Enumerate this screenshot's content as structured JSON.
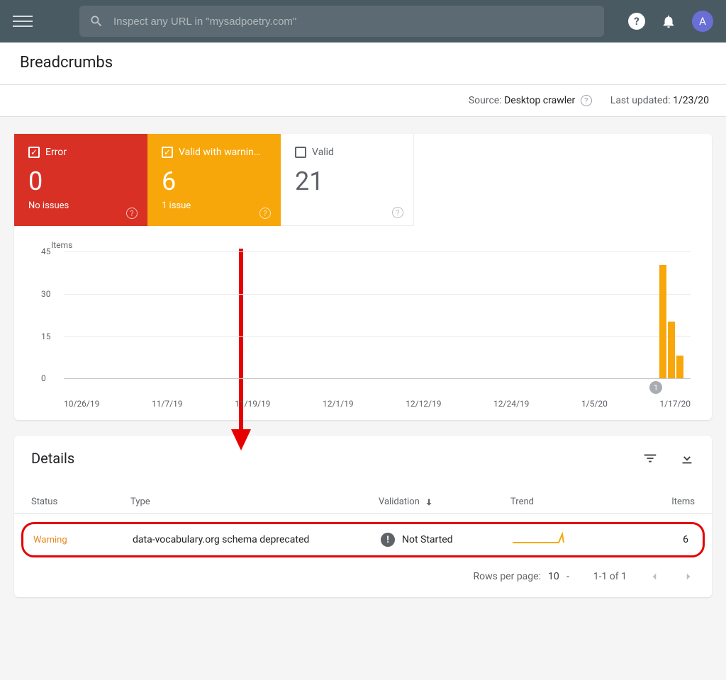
{
  "appbar": {
    "search_placeholder": "Inspect any URL in \"mysadpoetry.com\"",
    "avatar_initial": "A"
  },
  "page": {
    "title": "Breadcrumbs"
  },
  "meta": {
    "source_label": "Source:",
    "source_value": "Desktop crawler",
    "updated_label": "Last updated:",
    "updated_value": "1/23/20"
  },
  "tabs": {
    "error": {
      "label": "Error",
      "count": "0",
      "sub": "No issues"
    },
    "warn": {
      "label": "Valid with warnin…",
      "count": "6",
      "sub": "1 issue"
    },
    "valid": {
      "label": "Valid",
      "count": "21"
    }
  },
  "chart_data": {
    "type": "bar",
    "ylabel": "Items",
    "ylim": [
      0,
      45
    ],
    "y_ticks": [
      0,
      15,
      30,
      45
    ],
    "x_ticks": [
      "10/26/19",
      "11/7/19",
      "11/19/19",
      "12/1/19",
      "12/12/19",
      "12/24/19",
      "1/5/20",
      "1/17/20"
    ],
    "series": [
      {
        "name": "Valid with warnings",
        "bars": [
          {
            "x": "1/21/20",
            "value": 40
          },
          {
            "x": "1/22/20",
            "value": 20
          },
          {
            "x": "1/23/20",
            "value": 8
          }
        ]
      }
    ],
    "annotation": {
      "badge": "1"
    }
  },
  "details": {
    "title": "Details",
    "columns": {
      "status": "Status",
      "type": "Type",
      "validation": "Validation",
      "trend": "Trend",
      "items": "Items"
    },
    "row": {
      "status": "Warning",
      "type": "data-vocabulary.org schema deprecated",
      "validation": "Not Started",
      "items": "6"
    },
    "pager": {
      "rows_label": "Rows per page:",
      "rows_value": "10",
      "range": "1-1 of 1"
    }
  }
}
